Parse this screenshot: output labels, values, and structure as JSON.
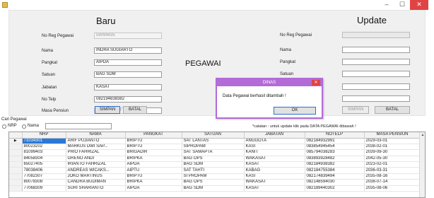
{
  "window": {
    "minimize": "–",
    "maximize": "☐",
    "close": "✕"
  },
  "left": {
    "title": "Baru",
    "labels": {
      "noreg": "No Reg Pegawai",
      "nama": "Nama",
      "pangkat": "Pangkat",
      "satuan": "Satuan",
      "jabatan": "Jabatan",
      "notelp": "No Telp",
      "masa": "Masa Pensiun"
    },
    "values": {
      "noreg": "59099435",
      "nama": "INDRA SUGIARTO",
      "pangkat": "AIPDA",
      "satuan": "BAG SDM",
      "jabatan": "KASAT",
      "notelp": "082194838382"
    },
    "masa": {
      "year": "2017",
      "month": "09",
      "day": "01"
    },
    "buttons": {
      "simpan": "SIMPAN",
      "batal": "BATAL"
    }
  },
  "center_title": "PEGAWAI",
  "right": {
    "title": "Update",
    "labels": {
      "noreg": "No Reg Pegawai",
      "nama": "Nama",
      "pangkat": "Pangkat",
      "satuan": "Satuan"
    },
    "buttons": {
      "simpan": "SIMPAN",
      "batal": "BATAL"
    }
  },
  "dialog": {
    "title": "DINAS",
    "message": "Data Pegawai berhasil ditambah !",
    "ok": "OK",
    "close": "✕"
  },
  "note": "*catatan : untuk update klik pada DATA PEGAWAI dibawah !",
  "search": {
    "label": "Cari Pegawai",
    "opt_nrp": "NRP",
    "opt_nama": "Nama"
  },
  "table": {
    "columns": [
      "NRP",
      "NAMA",
      "PANGKAT",
      "SATUAN",
      "JABATAN",
      "NOTELP",
      "MASA PENSIUN"
    ],
    "rows": [
      [
        "71034301",
        "ARIF PUJIANTO",
        "BRIPTU",
        "SAT LANTAS",
        "ANGGOTA",
        "082184932991",
        "2029-03-01"
      ],
      [
        "80023202",
        "MARKUS DWI SAP...",
        "BRIPTU",
        "SIPROPAM",
        "KASI",
        "083854945454",
        "2038-02-01"
      ],
      [
        "81099403",
        "PRIO FAHRIZAL",
        "BRIGADIR",
        "SAT SAMAPTA",
        "KANIT",
        "085794038283",
        "2039-09-30"
      ],
      [
        "84058304",
        "GRENO ANDI",
        "BRIPKA",
        "BAG OPS",
        "WAKASAT",
        "083893928482",
        "2042-05-30"
      ],
      [
        "65027405",
        "IRIANTO FAHRIZAL",
        "AIPDA",
        "BAG SDM",
        "KASAT",
        "082184938382",
        "2023-02-01"
      ],
      [
        "78038406",
        "ANDREAS WICAKS...",
        "AIPTU",
        "SAT TAHTI",
        "KABAG",
        "082184755384",
        "2036-03-31"
      ],
      [
        "77082307",
        "JOKO MARTINUS",
        "BRIPTU",
        "SI PROPAM",
        "KASI",
        "082174839494",
        "2035-08-16"
      ],
      [
        "80078308",
        "CANDRA BUDIMAN",
        "BRIPKA",
        "BAG OPS",
        "WAKASAT",
        "082148594030",
        "2038-07-14"
      ],
      [
        "77068309",
        "SURI SHARIANTO",
        "AIPDA",
        "BAG SDM",
        "KASAT",
        "082189440302",
        "2035-08-06"
      ]
    ]
  }
}
